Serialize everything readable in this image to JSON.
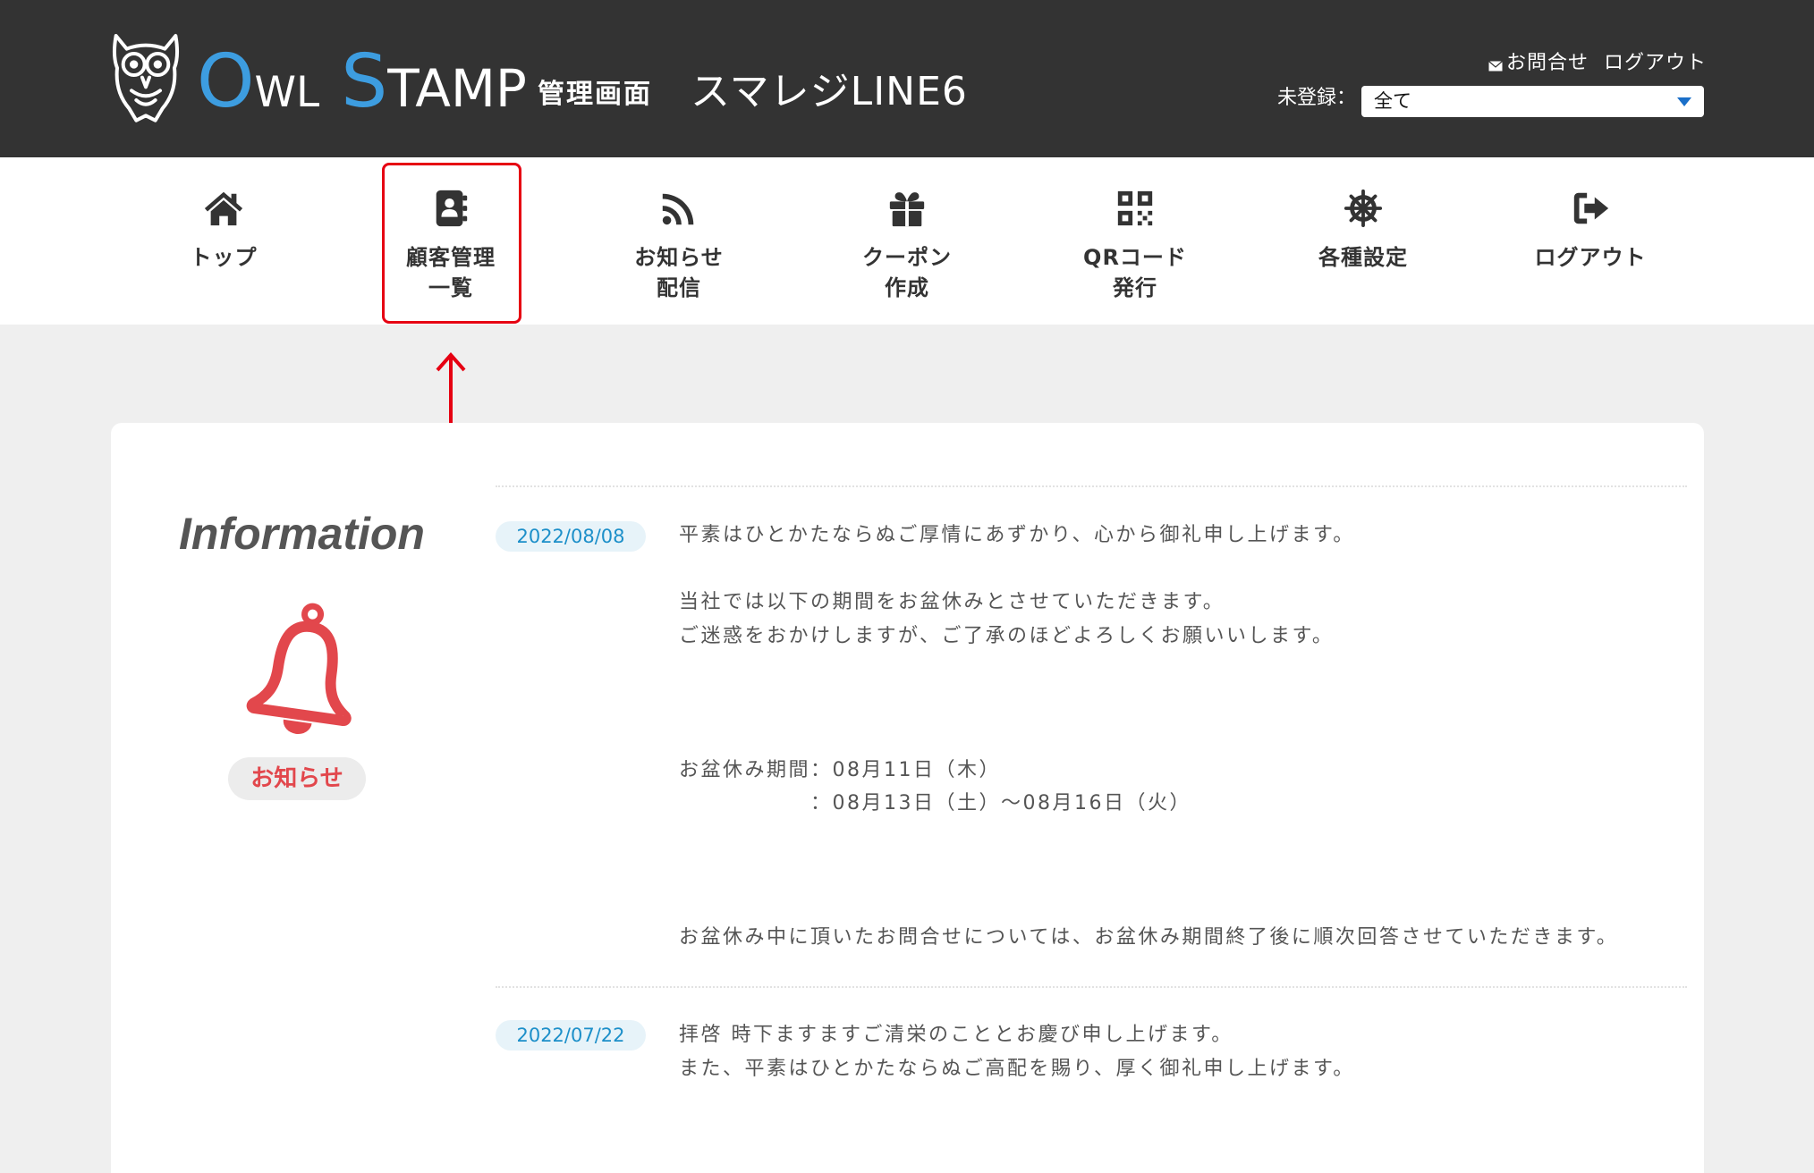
{
  "header": {
    "logo": {
      "part1": "O",
      "part2": "WL",
      "part3": "S",
      "part4": "TAMP"
    },
    "admin_label": "管理画面",
    "store_name": "スマレジLINE6",
    "contact_icon": "mail-icon",
    "contact_label": "お問合せ",
    "logout_label": "ログアウト",
    "filter_label": "未登録：",
    "filter_value": "全て"
  },
  "nav": [
    {
      "icon": "home-icon",
      "label_lines": [
        "トップ"
      ]
    },
    {
      "icon": "address-book-icon",
      "label_lines": [
        "顧客管理",
        "一覧"
      ],
      "highlighted": true
    },
    {
      "icon": "rss-icon",
      "label_lines": [
        "お知らせ",
        "配信"
      ]
    },
    {
      "icon": "gift-icon",
      "label_lines": [
        "クーポン",
        "作成"
      ]
    },
    {
      "icon": "qr-code-icon",
      "label_lines": [
        "QRコード",
        "発行"
      ]
    },
    {
      "icon": "ship-wheel-icon",
      "label_lines": [
        "各種設定"
      ]
    },
    {
      "icon": "sign-out-icon",
      "label_lines": [
        "ログアウト"
      ]
    }
  ],
  "info": {
    "title": "Information",
    "icon": "bell-icon",
    "badge": "お知らせ",
    "entries": [
      {
        "date": "2022/08/08",
        "paragraphs": [
          [
            "平素はひとかたならぬご厚情にあずかり、心から御礼申し上げます。"
          ],
          [
            "当社では以下の期間をお盆休みとさせていただきます。",
            "ご迷惑をおかけしますが、ご了承のほどよろしくお願いいします。"
          ],
          [
            "お盆休み期間：08月11日（木）",
            "：08月13日（土）〜08月16日（火）"
          ],
          [
            "お盆休み中に頂いたお問合せについては、お盆休み期間終了後に順次回答させていただきます。"
          ]
        ]
      },
      {
        "date": "2022/07/22",
        "paragraphs": [
          [
            "拝啓 時下ますますご清栄のこととお慶び申し上げます。",
            "また、平素はひとかたならぬご高配を賜り、厚く御礼申し上げます。"
          ]
        ]
      }
    ]
  },
  "colors": {
    "header_bg": "#333333",
    "logo_accent": "#3d9de0",
    "highlight": "#e60012",
    "bell": "#e2474c",
    "date_text": "#1c8fc9",
    "page_bg": "#efefef"
  }
}
